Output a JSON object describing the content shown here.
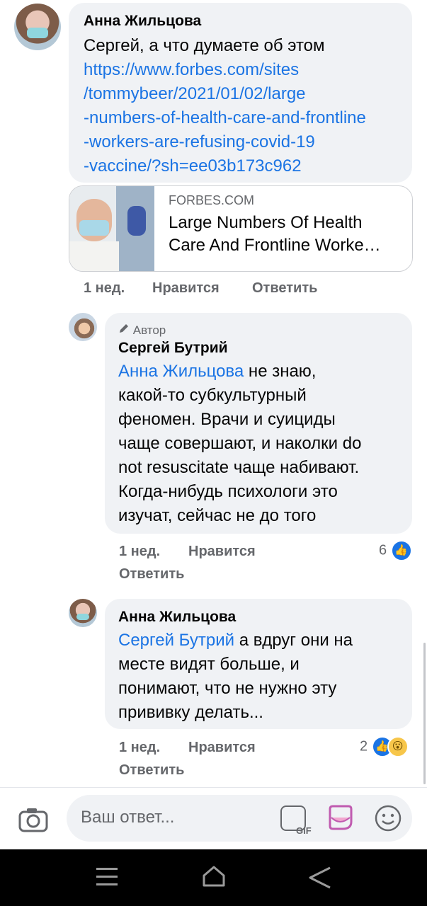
{
  "comments": [
    {
      "author": "Анна Жильцова",
      "text": "Сергей, а что думаете об этом",
      "link_lines": [
        "https://www.forbes.com/sites",
        "/tommybeer/2021/01/02/large",
        "-numbers-of-health-care-and-frontline",
        "-workers-are-refusing-covid-19",
        "-vaccine/?sh=ee03b173c962"
      ],
      "preview": {
        "domain": "FORBES.COM",
        "title_line1": "Large Numbers Of Health",
        "title_line2": "Care And Frontline Worke…"
      },
      "time": "1 нед.",
      "like_label": "Нравится",
      "reply_label": "Ответить"
    },
    {
      "badge": "Автор",
      "author": "Сергей Бутрий",
      "mention": "Анна Жильцова",
      "lines": [
        " не знаю,",
        "какой-то субкультурный",
        "феномен. Врачи и суициды",
        "чаще совершают, и наколки do",
        "not resuscitate чаще набивают.",
        "Когда-нибудь психологи это",
        "изучат, сейчас не до того"
      ],
      "time": "1 нед.",
      "like_label": "Нравится",
      "reply_label": "Ответить",
      "reaction_count": "6",
      "reactions": [
        "like"
      ]
    },
    {
      "author": "Анна Жильцова",
      "mention": "Сергей Бутрий",
      "lines": [
        " а вдруг они на",
        "месте видят больше, и",
        "понимают, что не нужно эту",
        "прививку делать..."
      ],
      "time": "1 нед.",
      "like_label": "Нравится",
      "reply_label": "Ответить",
      "reaction_count": "2",
      "reactions": [
        "like",
        "wow"
      ]
    }
  ],
  "reply_bar": {
    "placeholder": "Ваш ответ...",
    "gif_label": "GIF"
  },
  "colors": {
    "link": "#1b74e4",
    "bubble": "#f0f2f5",
    "meta": "#65676b"
  }
}
